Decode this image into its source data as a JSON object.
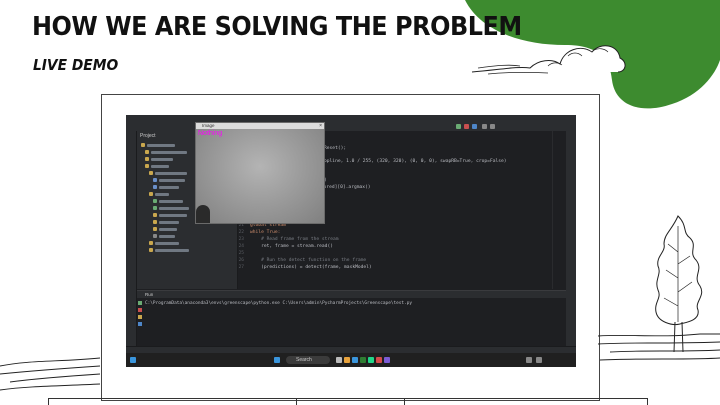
{
  "slide": {
    "title": "HOW WE ARE SOLVING THE PROBLEM",
    "subtitle": "LIVE DEMO"
  },
  "colors": {
    "accent_green": "#3d8b2f",
    "title_ink": "#111111",
    "detection_label": "#ff00ff",
    "ide_background": "#1e1f22"
  },
  "screenshot": {
    "ide_tab_label": "Project",
    "camera_window": {
      "title": "Image",
      "detection_label": "Nothing",
      "close_glyph": "×"
    },
    "code_lines": [
      {
        "n": "21",
        "text": "global stream"
      },
      {
        "n": "22",
        "text": "while True:"
      },
      {
        "n": "23",
        "text": "    # Read frame from the stream"
      },
      {
        "n": "24",
        "text": "    ret, frame = stream.read()"
      },
      {
        "n": "25",
        "text": ""
      },
      {
        "n": "26",
        "text": "    # Run the detect function on the frame"
      },
      {
        "n": "27",
        "text": "    (predictions) = detect(frame, maskModel)"
      }
    ],
    "upper_code": [
      {
        "text": "Reset();"
      },
      {
        "text": "opline, 1.0 / 255, (320, 320), (0, 0, 0), swapRB=True, crop=False)"
      },
      {
        "text": ")"
      },
      {
        "text": "/[pred][0].argmax()"
      }
    ],
    "run_tab": "Run",
    "run_command": "C:\\ProgramData\\anaconda3\\envs\\greenscape\\python.exe C:\\Users\\admin\\PycharmProjects\\Greenscape\\test.py",
    "taskbar_search": "Search"
  }
}
